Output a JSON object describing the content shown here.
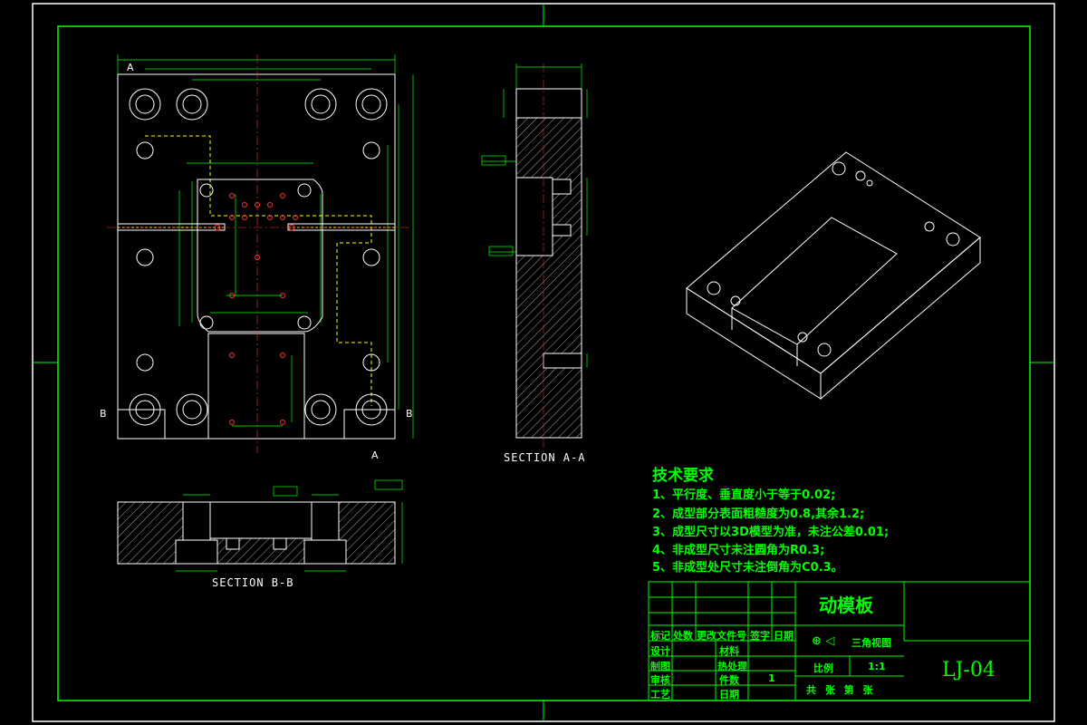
{
  "views": {
    "section_aa": "SECTION A-A",
    "section_bb": "SECTION B-B",
    "cut_a": "A",
    "cut_b": "B"
  },
  "tech": {
    "title": "技术要求",
    "items": [
      "1、平行度、垂直度小于等于0.02;",
      "2、成型部分表面粗糙度为0.8,其余1.2;",
      "3、成型尺寸以3D模型为准，未注公差0.01;",
      "4、非成型尺寸未注圆角为R0.3;",
      "5、非成型处尺寸未注倒角为C0.3。"
    ]
  },
  "title_block": {
    "part_name": "动模板",
    "drawing_no": "LJ-04",
    "projection": "三角视图",
    "scale_label": "比例",
    "scale_value": "1:1",
    "sheets": "共  张  第  张",
    "header": [
      "标记",
      "处数",
      "更改文件号",
      "签字",
      "日期"
    ],
    "rows": [
      "设计",
      "制图",
      "审核",
      "工艺"
    ],
    "material": "材料",
    "heat": "热处理",
    "qty_label": "件数",
    "qty_value": "1",
    "date_label": "日期"
  }
}
